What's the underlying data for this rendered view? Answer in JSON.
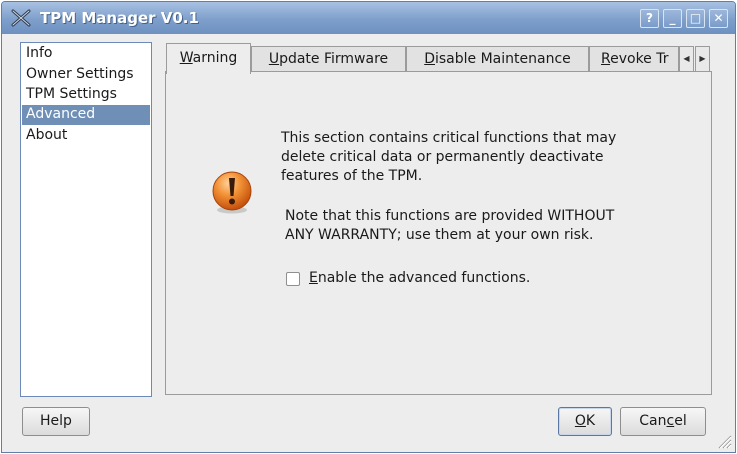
{
  "window": {
    "title": "TPM Manager V0.1",
    "buttons": {
      "help": "?",
      "minimize": "_",
      "maximize": "□",
      "close": "✕"
    }
  },
  "sidebar": {
    "items": [
      {
        "label": "Info",
        "selected": false
      },
      {
        "label": "Owner Settings",
        "selected": false
      },
      {
        "label": "TPM Settings",
        "selected": false
      },
      {
        "label": "Advanced",
        "selected": true
      },
      {
        "label": "About",
        "selected": false
      }
    ]
  },
  "tabs": {
    "items": [
      {
        "label": "Warning",
        "mnemonic": "W",
        "rest": "arning",
        "active": true
      },
      {
        "label": "Update Firmware",
        "mnemonic": "U",
        "rest": "pdate Firmware",
        "active": false
      },
      {
        "label": "Disable Maintenance",
        "mnemonic": "D",
        "rest": "isable Maintenance",
        "active": false
      },
      {
        "label": "Revoke Tr",
        "mnemonic": "R",
        "rest": "evoke Tr",
        "active": false
      }
    ],
    "scroll_left": "◀",
    "scroll_right": "▶"
  },
  "warning": {
    "icon": "exclamation-icon",
    "paragraph1": [
      "This section contains critical functions that may",
      "delete critical data or permanently deactivate",
      "features of the TPM."
    ],
    "paragraph2": [
      "Note that this functions are provided WITHOUT",
      "ANY WARRANTY; use them at your own risk."
    ],
    "checkbox": {
      "label": "Enable the advanced functions.",
      "mnemonic": "E",
      "rest": "nable the advanced functions.",
      "checked": false
    }
  },
  "footer": {
    "help_label": "Help",
    "ok_label": "OK",
    "ok_mnemonic": "O",
    "ok_rest": "K",
    "cancel_label": "Cancel",
    "cancel_pre": "Can",
    "cancel_mnemonic": "c",
    "cancel_post": "el"
  },
  "colors": {
    "titlebar": "#7e9fcb",
    "selection": "#6f8fb7",
    "warning_icon": "#e8731c"
  }
}
